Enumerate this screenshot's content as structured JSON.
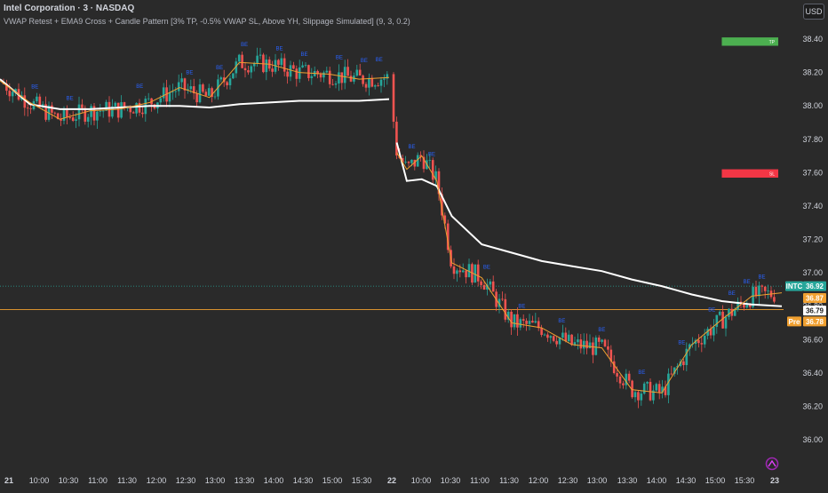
{
  "header": {
    "title": "Intel Corporation · 3 · NASDAQ",
    "subtitle": "VWAP Retest + EMA9 Cross + Candle Pattern [3% TP, -0.5% VWAP SL, Above YH, Slippage Simulated] (9, 3, 0.2)",
    "currency_button": "USD"
  },
  "colors": {
    "background": "#2a2a2a",
    "up": "#26a69a",
    "down": "#ef5350",
    "vwap": "#ffffff",
    "ema": "#f0a030",
    "tp_box": "#4caf50",
    "sl_box": "#f23645",
    "signal_text": "#2962ff"
  },
  "chart_data": {
    "type": "candlestick",
    "ylim": [
      35.95,
      38.5
    ],
    "y_ticks": [
      "38.40",
      "38.20",
      "38.00",
      "37.80",
      "37.60",
      "37.40",
      "37.20",
      "37.00",
      "36.80",
      "36.60",
      "36.40",
      "36.20",
      "36.00"
    ],
    "x_ticks": [
      "21",
      "10:00",
      "10:30",
      "11:00",
      "11:30",
      "12:00",
      "12:30",
      "13:00",
      "13:30",
      "14:00",
      "14:30",
      "15:00",
      "15:30",
      "22",
      "10:00",
      "10:30",
      "11:00",
      "11:30",
      "12:00",
      "12:30",
      "13:00",
      "13:30",
      "14:00",
      "14:30",
      "15:00",
      "15:30",
      "23"
    ],
    "price_tags": {
      "symbol": "INTC",
      "last_price": "36.92",
      "orange_level": "36.87",
      "white_level": "36.79",
      "pre_label": "Pre",
      "pre_price": "36.78"
    },
    "tp_box": {
      "label": "TP",
      "top": 38.41,
      "bottom": 38.36,
      "start_time": "15:00"
    },
    "sl_box": {
      "label": "SL",
      "top": 37.62,
      "bottom": 37.57,
      "start_time": "15:00"
    },
    "signal_labels": [
      "BE",
      "BE",
      "BE",
      "BE",
      "BE",
      "BE",
      "BE",
      "BE",
      "BE",
      "BE",
      "BE",
      "BE",
      "BE",
      "BE",
      "BE",
      "BE",
      "BE",
      "BE",
      "BE",
      "BE",
      "BE",
      "BE",
      "BE"
    ],
    "vwap_path": [
      {
        "t": "21 09:30",
        "v": 38.16
      },
      {
        "t": "21 10:00",
        "v": 38.01
      },
      {
        "t": "21 10:30",
        "v": 37.98
      },
      {
        "t": "21 11:00",
        "v": 37.98
      },
      {
        "t": "21 11:30",
        "v": 37.99
      },
      {
        "t": "21 12:00",
        "v": 38.0
      },
      {
        "t": "21 12:30",
        "v": 38.0
      },
      {
        "t": "21 13:00",
        "v": 37.99
      },
      {
        "t": "21 13:30",
        "v": 38.01
      },
      {
        "t": "21 14:00",
        "v": 38.02
      },
      {
        "t": "21 14:30",
        "v": 38.03
      },
      {
        "t": "21 15:00",
        "v": 38.03
      },
      {
        "t": "21 15:30",
        "v": 38.03
      },
      {
        "t": "21 16:00",
        "v": 38.04
      },
      {
        "t": "22 09:35",
        "v": 37.78
      },
      {
        "t": "22 09:45",
        "v": 37.55
      },
      {
        "t": "22 10:00",
        "v": 37.56
      },
      {
        "t": "22 10:15",
        "v": 37.52
      },
      {
        "t": "22 10:30",
        "v": 37.34
      },
      {
        "t": "22 11:00",
        "v": 37.17
      },
      {
        "t": "22 11:30",
        "v": 37.12
      },
      {
        "t": "22 12:00",
        "v": 37.07
      },
      {
        "t": "22 12:30",
        "v": 37.04
      },
      {
        "t": "22 13:00",
        "v": 37.01
      },
      {
        "t": "22 13:30",
        "v": 36.96
      },
      {
        "t": "22 14:00",
        "v": 36.92
      },
      {
        "t": "22 14:30",
        "v": 36.87
      },
      {
        "t": "22 15:00",
        "v": 36.83
      },
      {
        "t": "22 15:30",
        "v": 36.81
      },
      {
        "t": "22 16:00",
        "v": 36.8
      }
    ],
    "ema_path": [
      {
        "t": "21 09:30",
        "v": 38.15
      },
      {
        "t": "21 10:00",
        "v": 38.02
      },
      {
        "t": "21 10:30",
        "v": 37.92
      },
      {
        "t": "21 11:00",
        "v": 37.97
      },
      {
        "t": "21 11:30",
        "v": 37.98
      },
      {
        "t": "21 12:00",
        "v": 38.02
      },
      {
        "t": "21 12:30",
        "v": 38.11
      },
      {
        "t": "21 13:00",
        "v": 38.05
      },
      {
        "t": "21 13:30",
        "v": 38.26
      },
      {
        "t": "21 14:00",
        "v": 38.25
      },
      {
        "t": "21 14:30",
        "v": 38.2
      },
      {
        "t": "21 15:00",
        "v": 38.19
      },
      {
        "t": "21 15:30",
        "v": 38.16
      },
      {
        "t": "21 16:00",
        "v": 38.17
      },
      {
        "t": "22 09:35",
        "v": 37.72
      },
      {
        "t": "22 09:45",
        "v": 37.62
      },
      {
        "t": "22 10:00",
        "v": 37.7
      },
      {
        "t": "22 10:15",
        "v": 37.55
      },
      {
        "t": "22 10:30",
        "v": 37.06
      },
      {
        "t": "22 11:00",
        "v": 36.97
      },
      {
        "t": "22 11:30",
        "v": 36.7
      },
      {
        "t": "22 12:00",
        "v": 36.67
      },
      {
        "t": "22 12:30",
        "v": 36.57
      },
      {
        "t": "22 13:00",
        "v": 36.55
      },
      {
        "t": "22 13:30",
        "v": 36.3
      },
      {
        "t": "22 14:00",
        "v": 36.28
      },
      {
        "t": "22 14:30",
        "v": 36.57
      },
      {
        "t": "22 15:00",
        "v": 36.72
      },
      {
        "t": "22 15:30",
        "v": 36.86
      },
      {
        "t": "22 16:00",
        "v": 36.88
      }
    ]
  }
}
